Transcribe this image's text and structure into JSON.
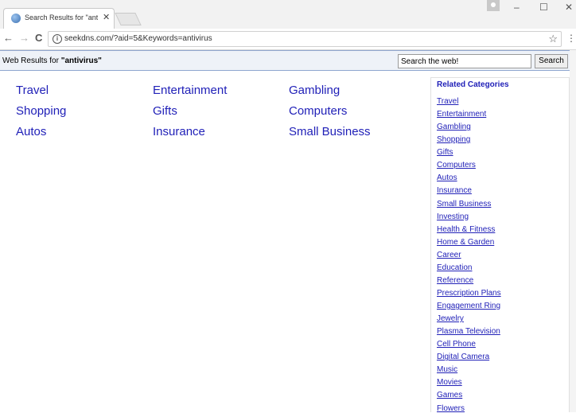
{
  "browser": {
    "tab_title": "Search Results for \"antivi",
    "tab_close": "✕",
    "win_min": "–",
    "win_max": "☐",
    "win_close": "✕",
    "back": "←",
    "forward": "→",
    "reload": "C",
    "info": "i",
    "url": "seekdns.com/?aid=5&Keywords=antivirus",
    "star": "☆",
    "menu": "⋮"
  },
  "header": {
    "results_prefix": "Web Results for ",
    "query": "\"antivirus\"",
    "search_value": "Search the web!",
    "search_button": "Search"
  },
  "categories": [
    "Travel",
    "Entertainment",
    "Gambling",
    "Shopping",
    "Gifts",
    "Computers",
    "Autos",
    "Insurance",
    "Small Business"
  ],
  "sidebar": {
    "title": "Related Categories",
    "items": [
      "Travel",
      "Entertainment",
      "Gambling",
      "Shopping",
      "Gifts",
      "Computers",
      "Autos",
      "Insurance",
      "Small Business",
      "Investing",
      "Health & Fitness",
      "Home & Garden",
      "Career",
      "Education",
      "Reference",
      "Prescription Plans",
      "Engagement Ring",
      "Jewelry",
      "Plasma Television",
      "Cell Phone",
      "Digital Camera",
      "Music",
      "Movies",
      "Games",
      "Flowers"
    ]
  }
}
